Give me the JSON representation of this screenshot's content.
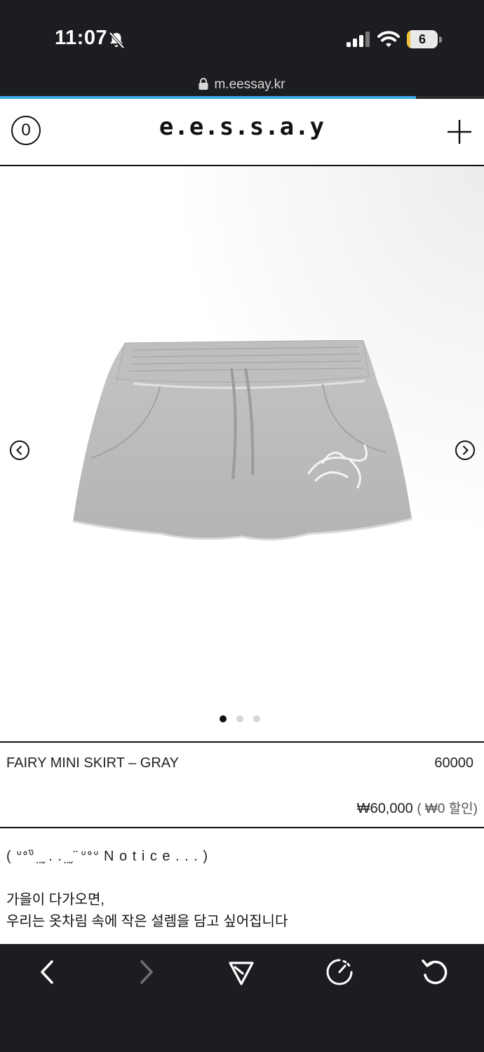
{
  "status_bar": {
    "time": "11:07",
    "battery_level": "6",
    "battery_fraction": 0.12,
    "url": "m.eessay.kr",
    "load_progress": 0.86
  },
  "header": {
    "cart_count": "0",
    "logo": "e.e.s.s.a.y"
  },
  "gallery": {
    "slide_count": 3,
    "active_slide": 1
  },
  "product": {
    "name": "FAIRY MINI SKIRT – GRAY",
    "code": "60000",
    "price": "₩60,000",
    "discount": "( ₩0 할인)"
  },
  "description": {
    "notice": "( ᐡᐤᐡ̈ ̤ ̮ . . ̤ ̮ ̈ ᐡᐤᐡ N o t i c e . . . )",
    "line1": "가을이 다가오면,",
    "line2": "우리는 옷차림 속에 작은 설렘을 담고 싶어집니다"
  },
  "toolbar": {
    "icons": [
      "back-icon",
      "forward-icon",
      "share-icon",
      "speed-icon",
      "reload-icon"
    ]
  },
  "colors": {
    "status_bg": "#1b1d20",
    "progress": "#3aa7e8",
    "skirt": "#b9b9b9"
  }
}
